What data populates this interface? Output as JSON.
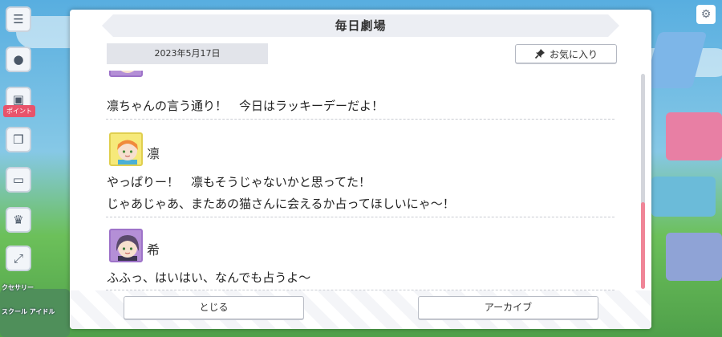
{
  "dialog": {
    "title": "毎日劇場",
    "date": "2023年5月17日",
    "favorite_label": "お気に入り",
    "close_label": "とじる",
    "archive_label": "アーカイブ"
  },
  "conversation": {
    "lines": [
      {
        "text": "凛ちゃんの言う通り！　今日はラッキーデーだよ！"
      },
      {
        "speaker": "凛",
        "text": "やっぱりー！　凛もそうじゃないかと思ってた！"
      },
      {
        "text": "じゃあじゃあ、またあの猫さんに会えるか占ってほしいにゃ～！"
      },
      {
        "speaker": "希",
        "text": "ふふっ、はいはい、なんでも占うよ～"
      }
    ]
  },
  "background": {
    "event_tag": "ポイント",
    "menu_labels": [
      "クセサリー",
      "スクール アイドル"
    ]
  },
  "icons": {
    "menu": "hamburger-icon",
    "pin": "pin-icon",
    "settings": "gear-icon"
  },
  "colors": {
    "scroll_thumb": "#f08597",
    "rin_avatar_bg": "#f6e97a",
    "nozomi_avatar_bg": "#b48fd6"
  }
}
